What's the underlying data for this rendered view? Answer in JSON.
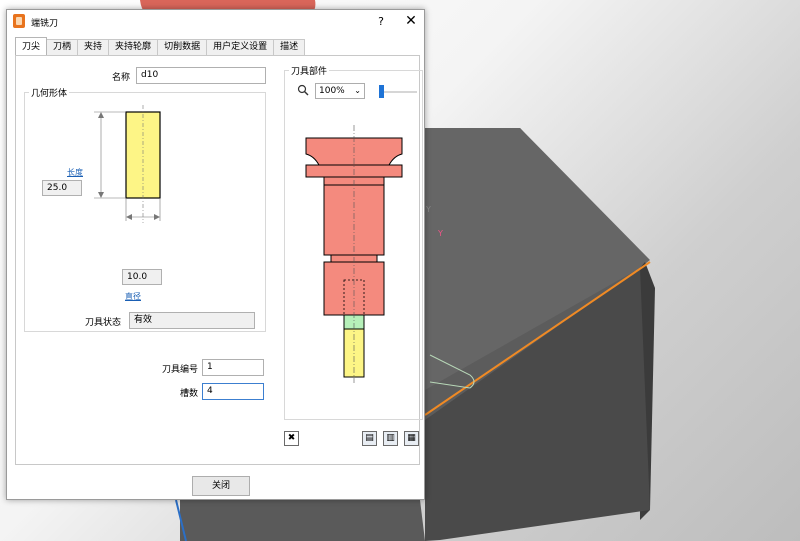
{
  "window": {
    "title": "端铣刀",
    "help_label": "?",
    "close_label": "✕"
  },
  "tabs": [
    {
      "label": "刀尖"
    },
    {
      "label": "刀柄"
    },
    {
      "label": "夹持"
    },
    {
      "label": "夹持轮廓"
    },
    {
      "label": "切削数据"
    },
    {
      "label": "用户定义设置"
    },
    {
      "label": "描述"
    }
  ],
  "tip": {
    "name_label": "名称",
    "name_value": "d10",
    "geometry_group": "几何形体",
    "length_link": "长度",
    "length_value": "25.0",
    "diameter_value": "10.0",
    "diameter_link": "直径",
    "status_label": "刀具状态",
    "status_value": "有效",
    "tool_number_label": "刀具编号",
    "tool_number_value": "1",
    "flutes_label": "槽数",
    "flutes_value": "4"
  },
  "assembly": {
    "group_title": "刀具部件",
    "zoom_value": "100%"
  },
  "footer": {
    "close_button": "关闭"
  },
  "colors": {
    "tool_tip": "#fdf586",
    "holder": "#f48a7e",
    "gauge": "#b6f0b9",
    "accent": "#1e73d6"
  },
  "icons": [
    "app-icon",
    "search-icon",
    "fit-view-icon",
    "tool-assembly-icon-1",
    "tool-assembly-icon-2",
    "tool-assembly-icon-3"
  ]
}
